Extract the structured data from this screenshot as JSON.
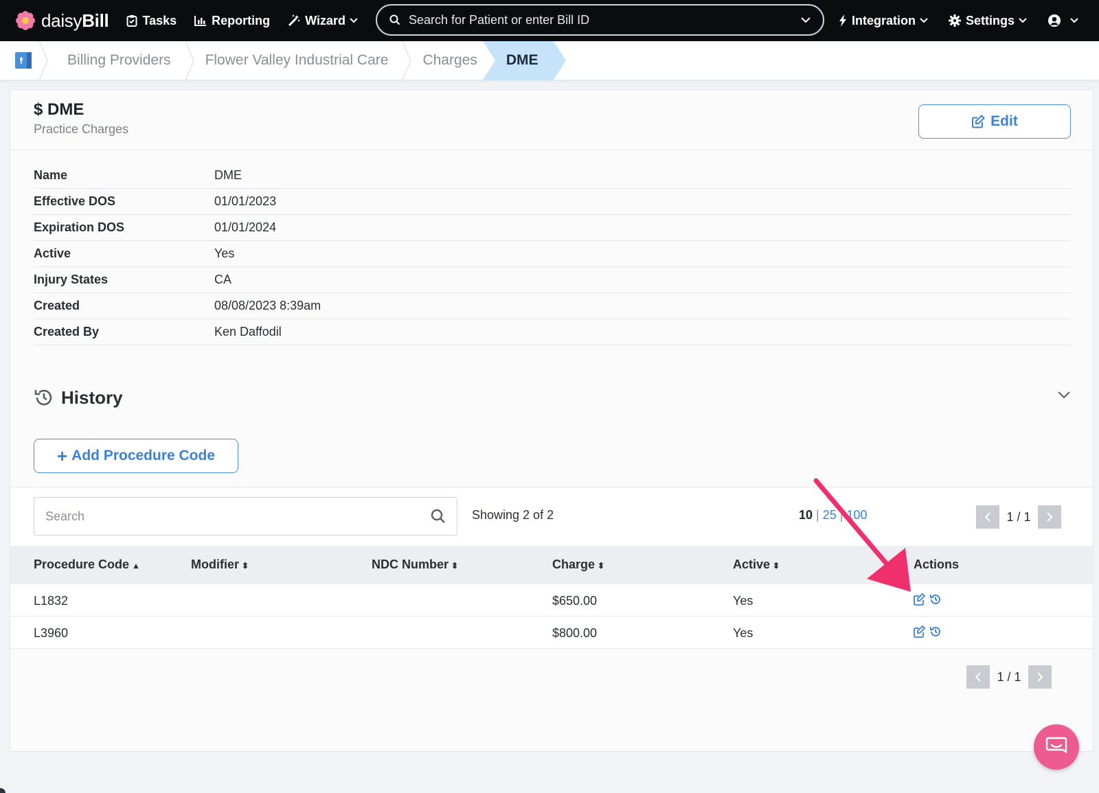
{
  "app": {
    "logo": {
      "prefix": "daisy",
      "suffix": "Bill"
    },
    "nav": {
      "tasks": "Tasks",
      "reporting": "Reporting",
      "wizard": "Wizard",
      "search_placeholder": "Search for Patient or enter Bill ID",
      "integration": "Integration",
      "settings": "Settings"
    }
  },
  "breadcrumb": {
    "items": [
      "Billing Providers",
      "Flower Valley Industrial Care",
      "Charges"
    ],
    "active": "DME"
  },
  "charge": {
    "title": "$ DME",
    "subtitle": "Practice Charges",
    "edit_label": "Edit",
    "details": [
      {
        "key": "Name",
        "value": "DME"
      },
      {
        "key": "Effective DOS",
        "value": "01/01/2023"
      },
      {
        "key": "Expiration DOS",
        "value": "01/01/2024"
      },
      {
        "key": "Active",
        "value": "Yes"
      },
      {
        "key": "Injury States",
        "value": "CA"
      },
      {
        "key": "Created",
        "value": "08/08/2023 8:39am"
      },
      {
        "key": "Created By",
        "value": "Ken Daffodil"
      }
    ],
    "history_label": "History",
    "add_procedure_label": "Add Procedure Code"
  },
  "table": {
    "search_placeholder": "Search",
    "showing": "Showing 2 of 2",
    "page_sizes": {
      "current": "10",
      "options": [
        "25",
        "100"
      ]
    },
    "page_indicator": "1 / 1",
    "columns": [
      "Procedure Code",
      "Modifier",
      "NDC Number",
      "Charge",
      "Active",
      "Actions"
    ],
    "rows": [
      {
        "code": "L1832",
        "modifier": "",
        "ndc": "",
        "charge": "$650.00",
        "active": "Yes"
      },
      {
        "code": "L3960",
        "modifier": "",
        "ndc": "",
        "charge": "$800.00",
        "active": "Yes"
      }
    ]
  },
  "colors": {
    "accent": "#3b82d4",
    "annotation_arrow": "#f0306e",
    "chat": "#ee5c8f"
  }
}
